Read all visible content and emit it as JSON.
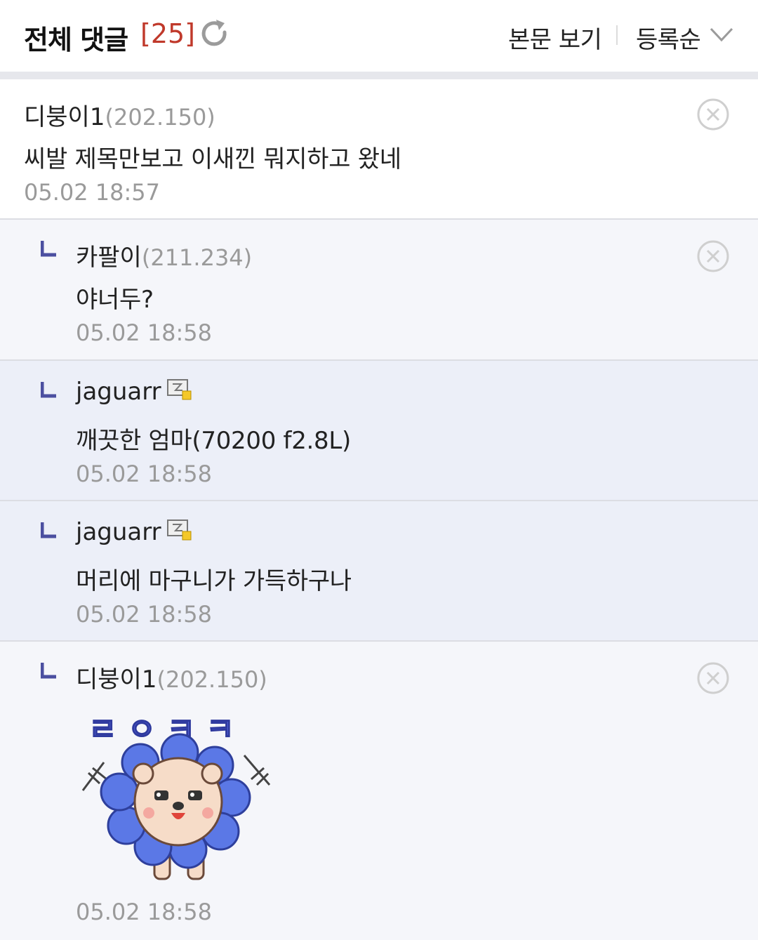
{
  "header": {
    "title": "전체 댓글",
    "count": "[25]",
    "view_body": "본문 보기",
    "sort": "등록순"
  },
  "comments": [
    {
      "author": "디붕이1",
      "ip": "(202.150)",
      "text": "씨발 제목만보고 이새낀 뭐지하고 왔네",
      "time": "05.02 18:57"
    },
    {
      "author": "카팔이",
      "ip": "(211.234)",
      "text": "야너두?",
      "time": "05.02 18:58"
    },
    {
      "author": "jaguarr",
      "ip": "",
      "text": "깨끗한 엄마(70200 f2.8L)",
      "time": "05.02 18:58"
    },
    {
      "author": "jaguarr",
      "ip": "",
      "text": "머리에 마구니가 가득하구나",
      "time": "05.02 18:58"
    },
    {
      "author": "디붕이1",
      "ip": "(202.150)",
      "text": "",
      "time": "05.02 18:58",
      "sticker_text": "ㄹㅇㅋㅋ"
    }
  ],
  "colors": {
    "count_red": "#c0392b",
    "reply_mark": "#4b4fa0",
    "sticker_purple": "#5a6ae0"
  },
  "icons": [
    "refresh-icon",
    "chevron-down-icon",
    "reply-arrow-icon",
    "close-circle-icon",
    "member-icon"
  ]
}
